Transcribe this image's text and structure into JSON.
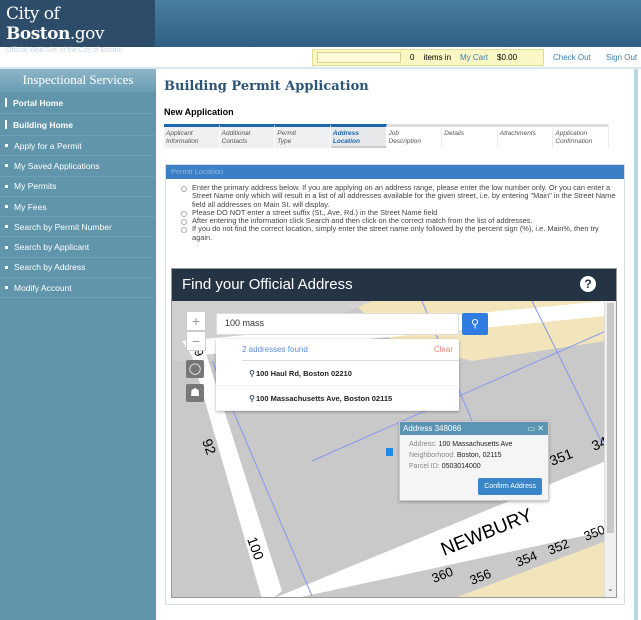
{
  "header": {
    "logo_city": "City of",
    "logo_boston": "Boston",
    "logo_gov": ".gov",
    "tagline": "Official Web Site of the City of Boston"
  },
  "cart": {
    "count": "0",
    "items_in": "items in",
    "my_cart": "My Cart",
    "total": "$0.00",
    "checkout": "Check Out",
    "signout": "Sign Out"
  },
  "sidebar": {
    "title": "Inspectional Services",
    "items": [
      {
        "label": "Portal Home"
      },
      {
        "label": "Building Home"
      },
      {
        "label": "Apply for a Permit"
      },
      {
        "label": "My Saved Applications"
      },
      {
        "label": "My Permits"
      },
      {
        "label": "My Fees"
      },
      {
        "label": "Search by Permit Number"
      },
      {
        "label": "Search by Applicant"
      },
      {
        "label": "Search by Address"
      },
      {
        "label": "Modify Account"
      }
    ]
  },
  "main": {
    "title": "Building Permit Application",
    "subtitle": "New Application",
    "steps": [
      {
        "l1": "Applicant",
        "l2": "Information"
      },
      {
        "l1": "Additional",
        "l2": "Contacts"
      },
      {
        "l1": "Permit",
        "l2": "Type"
      },
      {
        "l1": "Address",
        "l2": "Location"
      },
      {
        "l1": "Job",
        "l2": "Description"
      },
      {
        "l1": "Details",
        "l2": ""
      },
      {
        "l1": "Attachments",
        "l2": ""
      },
      {
        "l1": "Application",
        "l2": "Confirmation"
      }
    ],
    "panel_title": "Permit Location",
    "bullets": [
      "Enter the primary address below. If you are applying on an address range, please enter the low number only. Or you can enter a Street Name only which will result in a list of all addresses available for the given street, i.e. by entering \"Main\" in the Street Name field all addresses on Main St. will display.",
      "Please DO NOT enter a street suffix (St., Ave, Rd.) in the Street Name field",
      "After entering the information click Search and then click on the correct match from the list of addresses.",
      "If you do not find the correct location, simply enter the street name only followed by the percent sign (%), i.e. Main%, then try again."
    ]
  },
  "widget": {
    "title": "Find your Official Address",
    "help": "?",
    "search_value": "100 mass",
    "results_count": "2 addresses found",
    "clear": "Clear",
    "results": [
      "100 Haul Rd, Boston 02210",
      "100 Massachusetts Ave, Boston 02115"
    ],
    "popup": {
      "title": "Address 348066",
      "address_label": "Address:",
      "address": "100 Massachusetts Ave",
      "neighborhood_label": "Neighborhood:",
      "neighborhood": "Boston, 02115",
      "parcel_label": "Parcel ID:",
      "parcel": "0503014000",
      "confirm": "Confirm Address"
    },
    "map_labels": {
      "street": "NEWBURY",
      "n92": "92",
      "n100": "100",
      "n351": "351",
      "n360": "360",
      "n356": "356",
      "n354": "354",
      "n352": "352",
      "n350": "350",
      "n34": "34",
      "n9": "9"
    }
  }
}
